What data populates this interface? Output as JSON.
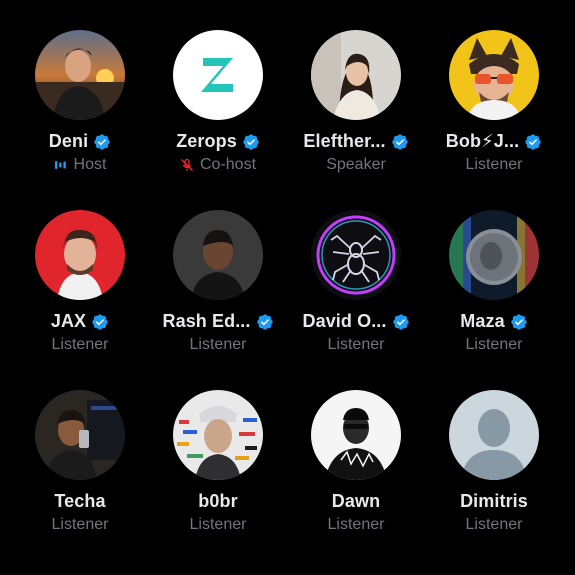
{
  "colors": {
    "background": "#000000",
    "name": "#e7e9ea",
    "role": "#71767b",
    "verified": "#1d9bf0",
    "muted": "#f4212e"
  },
  "participants": [
    {
      "name": "Deni",
      "role": "Host",
      "verified": true,
      "status_icon": "speaking-bars-icon"
    },
    {
      "name": "Zerops",
      "role": "Co-host",
      "verified": true,
      "status_icon": "mic-muted-icon"
    },
    {
      "name": "Elefther...",
      "role": "Speaker",
      "verified": true
    },
    {
      "name": "Bob⚡J...",
      "role": "Listener",
      "verified": true
    },
    {
      "name": "JAX",
      "role": "Listener",
      "verified": true
    },
    {
      "name": "Rash Ed...",
      "role": "Listener",
      "verified": true
    },
    {
      "name": "David O...",
      "role": "Listener",
      "verified": true
    },
    {
      "name": "Maza",
      "role": "Listener",
      "verified": true
    },
    {
      "name": "Techa",
      "role": "Listener",
      "verified": false
    },
    {
      "name": "b0br",
      "role": "Listener",
      "verified": false
    },
    {
      "name": "Dawn",
      "role": "Listener",
      "verified": false
    },
    {
      "name": "Dimitris",
      "role": "Listener",
      "verified": false
    }
  ]
}
